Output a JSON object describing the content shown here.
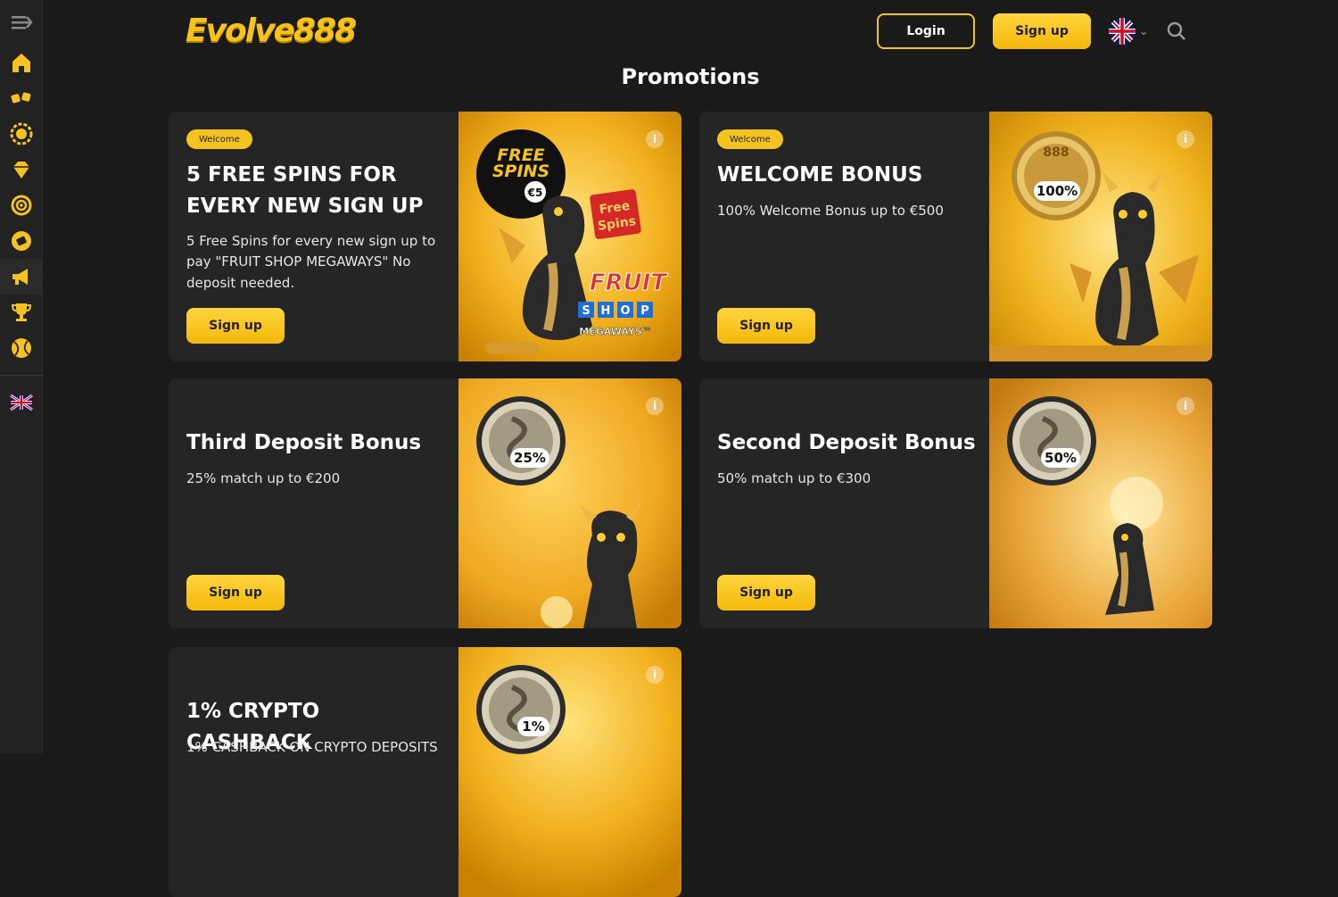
{
  "brand": {
    "logo_text": "Evolve888",
    "accent": "#f5c320"
  },
  "header": {
    "login_label": "Login",
    "signup_label": "Sign up",
    "language_icon": "uk-flag-icon",
    "search_icon": "search-icon"
  },
  "sidebar": {
    "items": [
      {
        "name": "menu-toggle",
        "icon": "menu-arrow-icon"
      },
      {
        "name": "home",
        "icon": "home-icon"
      },
      {
        "name": "live-casino",
        "icon": "dice-icon"
      },
      {
        "name": "casino",
        "icon": "sun-chip-icon"
      },
      {
        "name": "vip",
        "icon": "diamond-icon"
      },
      {
        "name": "target",
        "icon": "target-icon"
      },
      {
        "name": "lottery",
        "icon": "ticket-icon"
      },
      {
        "name": "promotions",
        "icon": "megaphone-icon"
      },
      {
        "name": "tournaments",
        "icon": "trophy-icon"
      },
      {
        "name": "sports",
        "icon": "ball-icon"
      },
      {
        "name": "language",
        "icon": "uk-flag-icon"
      }
    ]
  },
  "page": {
    "title": "Promotions"
  },
  "promotions": [
    {
      "badge": "Welcome",
      "title_line1": "5 FREE SPINS FOR",
      "title_line2": "EVERY NEW SIGN UP",
      "desc_line1": "5 Free Spins for every new sign up to",
      "desc_line2": "pay \"FRUIT SHOP MEGAWAYS\" No",
      "desc_line3": "deposit needed.",
      "button": "Sign up",
      "image": {
        "circle_line1": "FREE",
        "circle_line2": "SPINS",
        "circle_value": "€5",
        "sign_line1": "Free",
        "sign_line2": "Spins",
        "game_word1": "FRUIT",
        "game_letters": [
          "S",
          "H",
          "O",
          "P"
        ],
        "game_word3": "MEGAWAYS™"
      }
    },
    {
      "badge": "Welcome",
      "title_line1": "WELCOME BONUS",
      "desc_line1": "100% Welcome Bonus up to €500",
      "button": "Sign up",
      "image": {
        "coin_top": "888",
        "coin_label": "100%"
      }
    },
    {
      "title_line1": "Third Deposit Bonus",
      "desc_line1": "25% match up to €200",
      "button": "Sign up",
      "image": {
        "coin_label": "25%"
      }
    },
    {
      "title_line1": "Second Deposit Bonus",
      "desc_line1": "50% match up to €300",
      "button": "Sign up",
      "image": {
        "coin_label": "50%"
      }
    },
    {
      "title_line1": "1% CRYPTO CASHBACK",
      "desc_line1": "1% CASHBACK ON CRYPTO DEPOSITS",
      "image": {
        "coin_label": "1%"
      }
    }
  ],
  "info_icon_label": "i"
}
